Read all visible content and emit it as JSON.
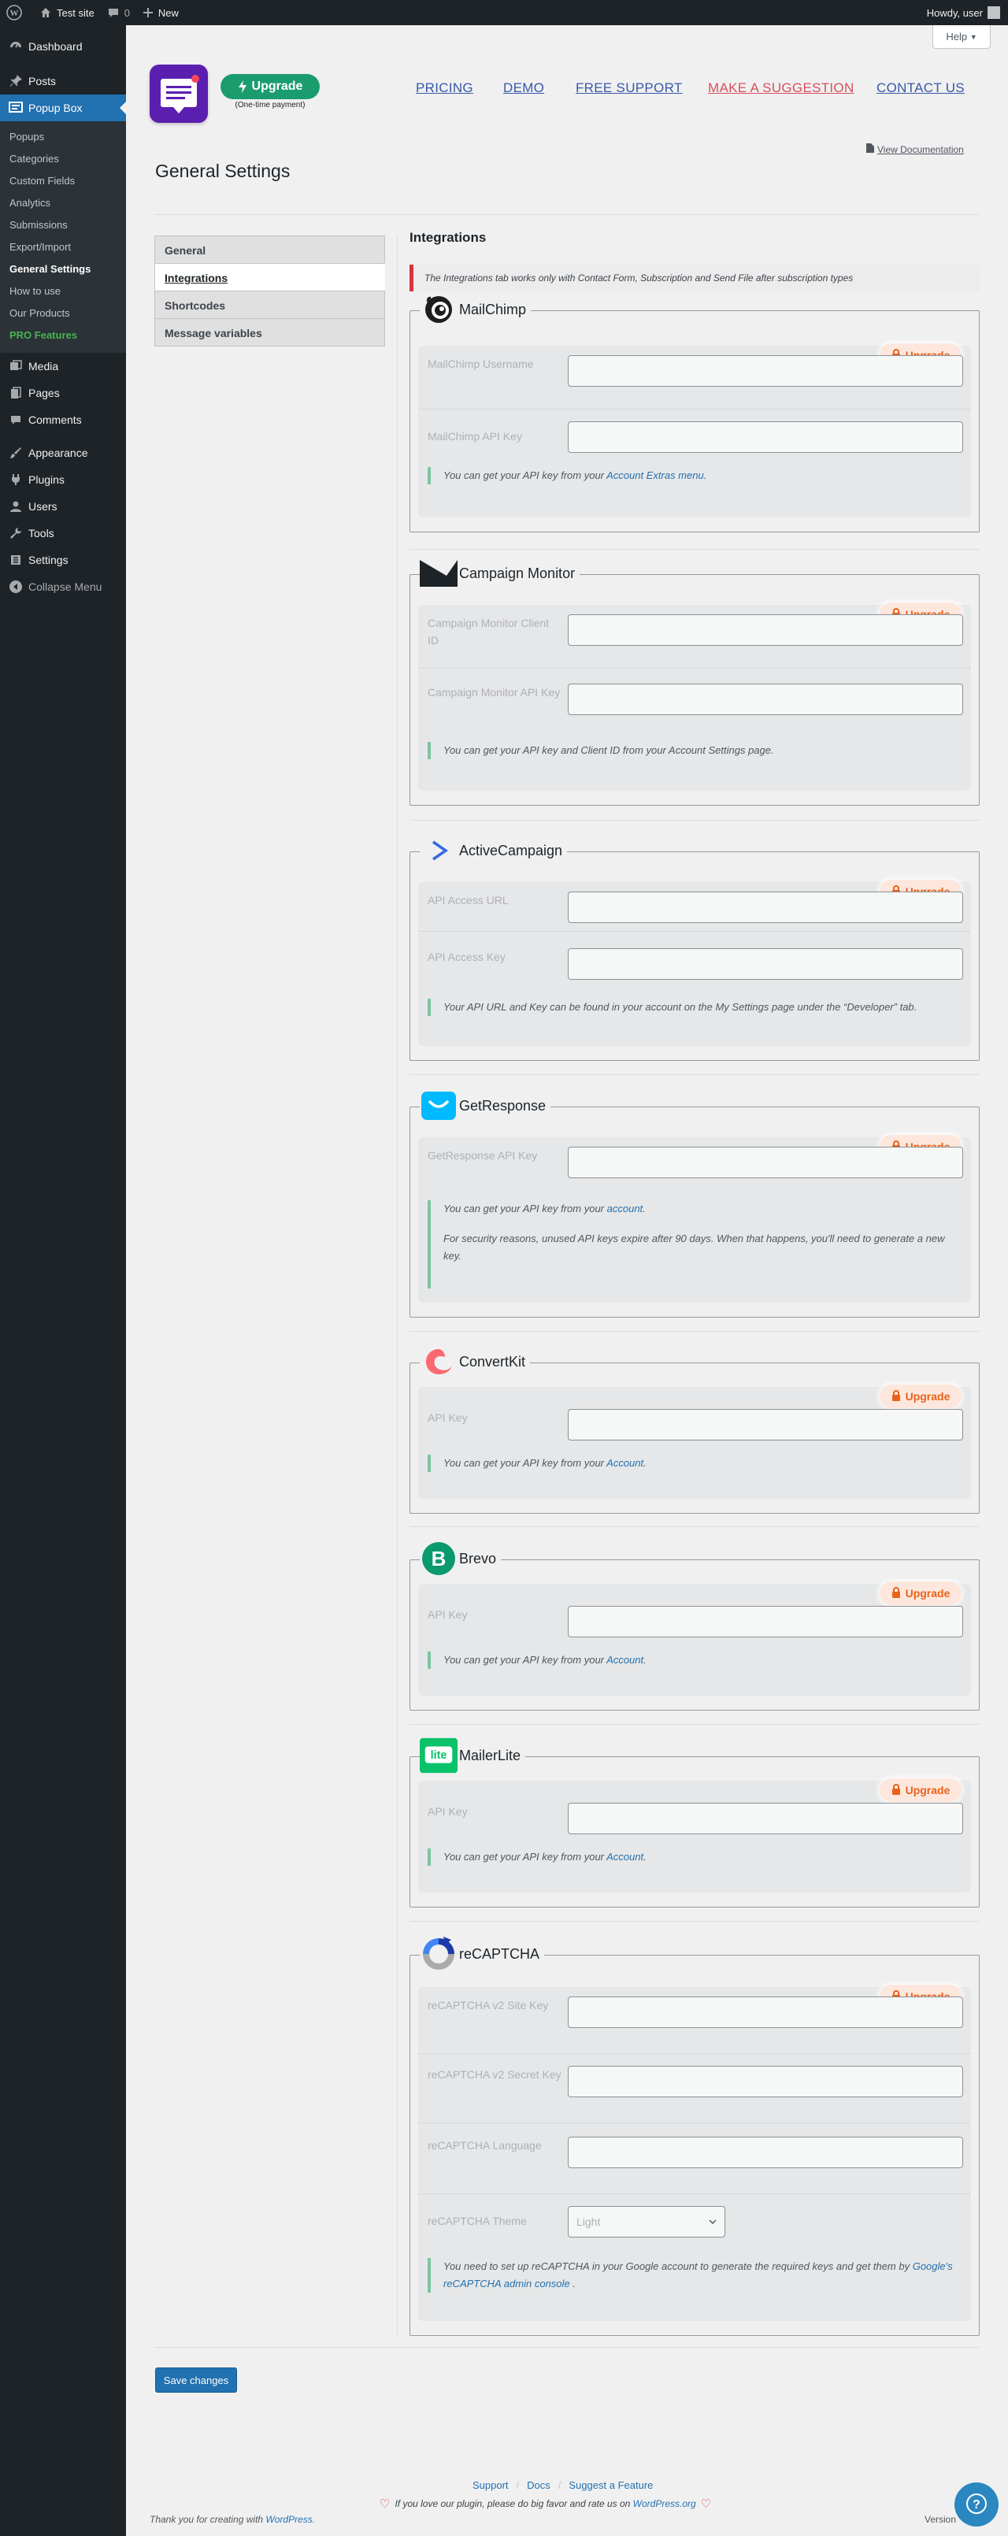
{
  "adminbar": {
    "site": "Test site",
    "comments": "0",
    "new": "New",
    "howdy": "Howdy, user"
  },
  "help_tab": "Help",
  "menu": {
    "dashboard": "Dashboard",
    "posts": "Posts",
    "popup_box": "Popup Box",
    "sub": [
      "Popups",
      "Categories",
      "Custom Fields",
      "Analytics",
      "Submissions",
      "Export/Import",
      "General Settings",
      "How to use",
      "Our Products",
      "PRO Features"
    ],
    "media": "Media",
    "pages": "Pages",
    "comments": "Comments",
    "appearance": "Appearance",
    "plugins": "Plugins",
    "users": "Users",
    "tools": "Tools",
    "settings": "Settings",
    "collapse": "Collapse Menu"
  },
  "header": {
    "upgrade": "Upgrade",
    "upgrade_note": "(One-time payment)",
    "links": [
      "PRICING",
      "DEMO",
      "FREE SUPPORT",
      "MAKE A SUGGESTION",
      "CONTACT US"
    ],
    "view_doc": "View Documentation"
  },
  "page_title": "General Settings",
  "tabs": [
    "General",
    "Integrations",
    "Shortcodes",
    "Message variables"
  ],
  "section_title": "Integrations",
  "notice": "The Integrations tab works only with Contact Form, Subscription and Send File after subscription types",
  "upgrade_label": "Upgrade",
  "mailchimp": {
    "title": "MailChimp",
    "f1": "MailChimp Username",
    "f2": "MailChimp API Key",
    "help": "You can get your API key from your ",
    "link": "Account Extras menu",
    "after": "."
  },
  "campaign": {
    "title": "Campaign Monitor",
    "f1": "Campaign Monitor Client ID",
    "f2": "Campaign Monitor API Key",
    "help": "You can get your API key and Client ID from your Account Settings page."
  },
  "activecampaign": {
    "title": "ActiveCampaign",
    "f1": "API Access URL",
    "f2": "API Access Key",
    "help": "Your API URL and Key can be found in your account on the My Settings page under the “Developer” tab."
  },
  "getresponse": {
    "title": "GetResponse",
    "f1": "GetResponse API Key",
    "help": "You can get your API key from your ",
    "link": "account",
    "after": ".",
    "help2": "For security reasons, unused API keys expire after 90 days. When that happens, you'll need to generate a new key."
  },
  "convertkit": {
    "title": "ConvertKit",
    "f1": "API Key",
    "help": "You can get your API key from your ",
    "link": "Account",
    "after": "."
  },
  "brevo": {
    "title": "Brevo",
    "f1": "API Key",
    "help": "You can get your API key from your ",
    "link": "Account",
    "after": "."
  },
  "mailerlite": {
    "title": "MailerLite",
    "logo": "lite",
    "f1": "API Key",
    "help": "You can get your API key from your ",
    "link": "Account",
    "after": "."
  },
  "recaptcha": {
    "title": "reCAPTCHA",
    "f1": "reCAPTCHA v2 Site Key",
    "f2": "reCAPTCHA v2 Secret Key",
    "f3": "reCAPTCHA Language",
    "f4": "reCAPTCHA Theme",
    "theme_value": "Light",
    "help": "You need to set up reCAPTCHA in your Google account to generate the required keys and get them by ",
    "link": "Google's reCAPTCHA admin console",
    "after": " ."
  },
  "save": "Save changes",
  "footer": {
    "links": [
      "Support",
      "Docs",
      "Suggest a Feature"
    ],
    "rate_pre": "If you love our plugin, please do big favor and rate us on ",
    "rate_link": "WordPress.org",
    "thanks_pre": "Thank you for creating with ",
    "thanks_link": "WordPress",
    "thanks_after": ".",
    "version": "Version"
  },
  "colors": {
    "wp_blue": "#2271b1",
    "upgrade_green": "#1b9c6f",
    "upgrade_orange": "#e8621b",
    "notice_red": "#d63638",
    "pro_green": "#46b450"
  }
}
